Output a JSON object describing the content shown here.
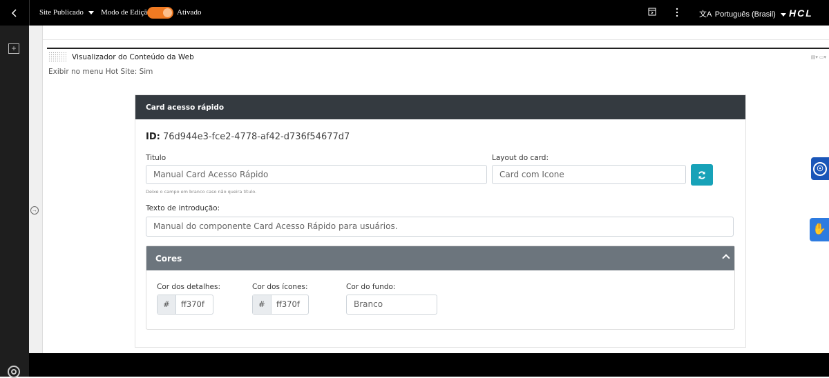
{
  "topbar": {
    "site_label": "Site Publicado",
    "edit_mode_label": "Modo de Edição:",
    "edit_mode_state": "Ativado",
    "language": "Português (Brasil)",
    "brand": "HCL",
    "accent_color": "#f07a22"
  },
  "portlet": {
    "title": "Visualizador do Conteúdo da Web",
    "hot_site": "Exibir no menu Hot Site: Sim"
  },
  "card": {
    "header": "Card acesso rápido",
    "id_label": "ID:",
    "id_value": "76d944e3-fce2-4778-af42-d736f54677d7",
    "title_label": "Titulo",
    "title_value": "Manual Card Acesso Rápido",
    "title_hint": "Deixe o campo em branco caso não queira título.",
    "layout_label": "Layout do card:",
    "layout_value": "Card com Icone",
    "intro_label": "Texto de introdução:",
    "intro_value": "Manual do componente Card Acesso Rápido para usuários.",
    "cores": {
      "header": "Cores",
      "detalhes_label": "Cor dos detalhes:",
      "detalhes_prefix": "#",
      "detalhes_value": "ff370f",
      "icones_label": "Cor dos ícones:",
      "icones_prefix": "#",
      "icones_value": "ff370f",
      "fundo_label": "Cor do fundo:",
      "fundo_value": "Branco"
    }
  },
  "colors": {
    "card_header": "#343a40",
    "cores_header": "#6c757d",
    "refresh_button": "#17a2b8",
    "accessibility_button": "#1a56b8"
  }
}
